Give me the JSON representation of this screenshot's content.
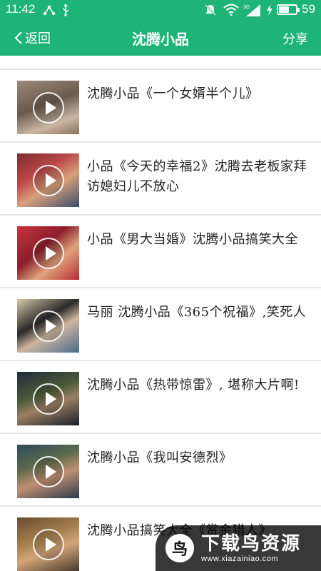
{
  "status_bar": {
    "time": "11:42",
    "left_icons": [
      "usb-share-icon",
      "usb-icon"
    ],
    "right_icons": [
      "mute-icon",
      "wifi-icon",
      "signal-3g-icon",
      "charging-icon"
    ],
    "battery_level": 59,
    "battery_text": "59"
  },
  "nav": {
    "back_label": "返回",
    "title": "沈腾小品",
    "share_label": "分享"
  },
  "theme": {
    "accent": "#1eb476"
  },
  "items": [
    {
      "title": "沈腾小品《一个女婿半个儿》"
    },
    {
      "title": "小品《今天的幸福2》沈腾去老板家拜访媳妇儿不放心"
    },
    {
      "title": "小品《男大当婚》沈腾小品搞笑大全"
    },
    {
      "title": "马丽 沈腾小品《365个祝福》,笑死人"
    },
    {
      "title": "沈腾小品《热带惊雷》, 堪称大片啊!"
    },
    {
      "title": "沈腾小品《我叫安德烈》"
    },
    {
      "title": "沈腾小品搞笑大全《赏金猎人》"
    }
  ],
  "watermark": {
    "name": "下载鸟资源",
    "url": "www.xiazainiao.com"
  }
}
